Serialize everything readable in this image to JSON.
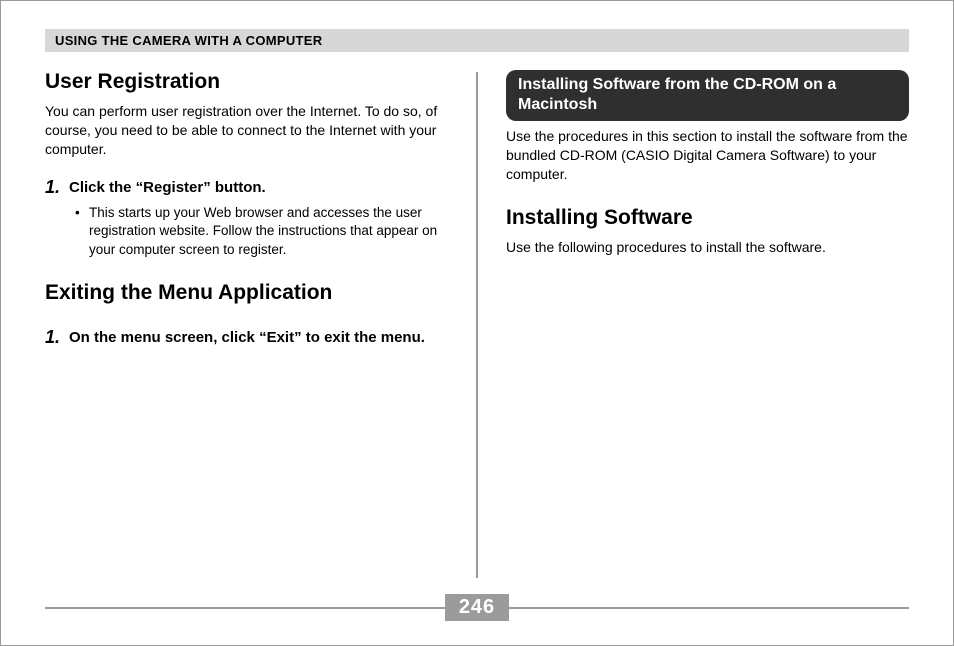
{
  "header": {
    "title": "USING THE CAMERA WITH A COMPUTER"
  },
  "left": {
    "section1": {
      "heading": "User Registration",
      "intro": "You can perform user registration over the Internet. To do so, of course, you need to be able to connect to the Internet with your computer.",
      "step_num": "1.",
      "step_text": "Click the “Register” button.",
      "bullet": "This starts up your Web browser and accesses the user registration website. Follow the instructions that appear on your computer screen to register."
    },
    "section2": {
      "heading": "Exiting the Menu Application",
      "step_num": "1.",
      "step_text": "On the menu screen, click “Exit” to exit the menu."
    }
  },
  "right": {
    "callout": "Installing Software from the CD-ROM on a Macintosh",
    "callout_body": "Use the procedures in this section to install the software from the bundled CD-ROM (CASIO Digital Camera Software) to your computer.",
    "section": {
      "heading": "Installing Software",
      "body": "Use the following procedures to install the software."
    }
  },
  "page_number": "246"
}
